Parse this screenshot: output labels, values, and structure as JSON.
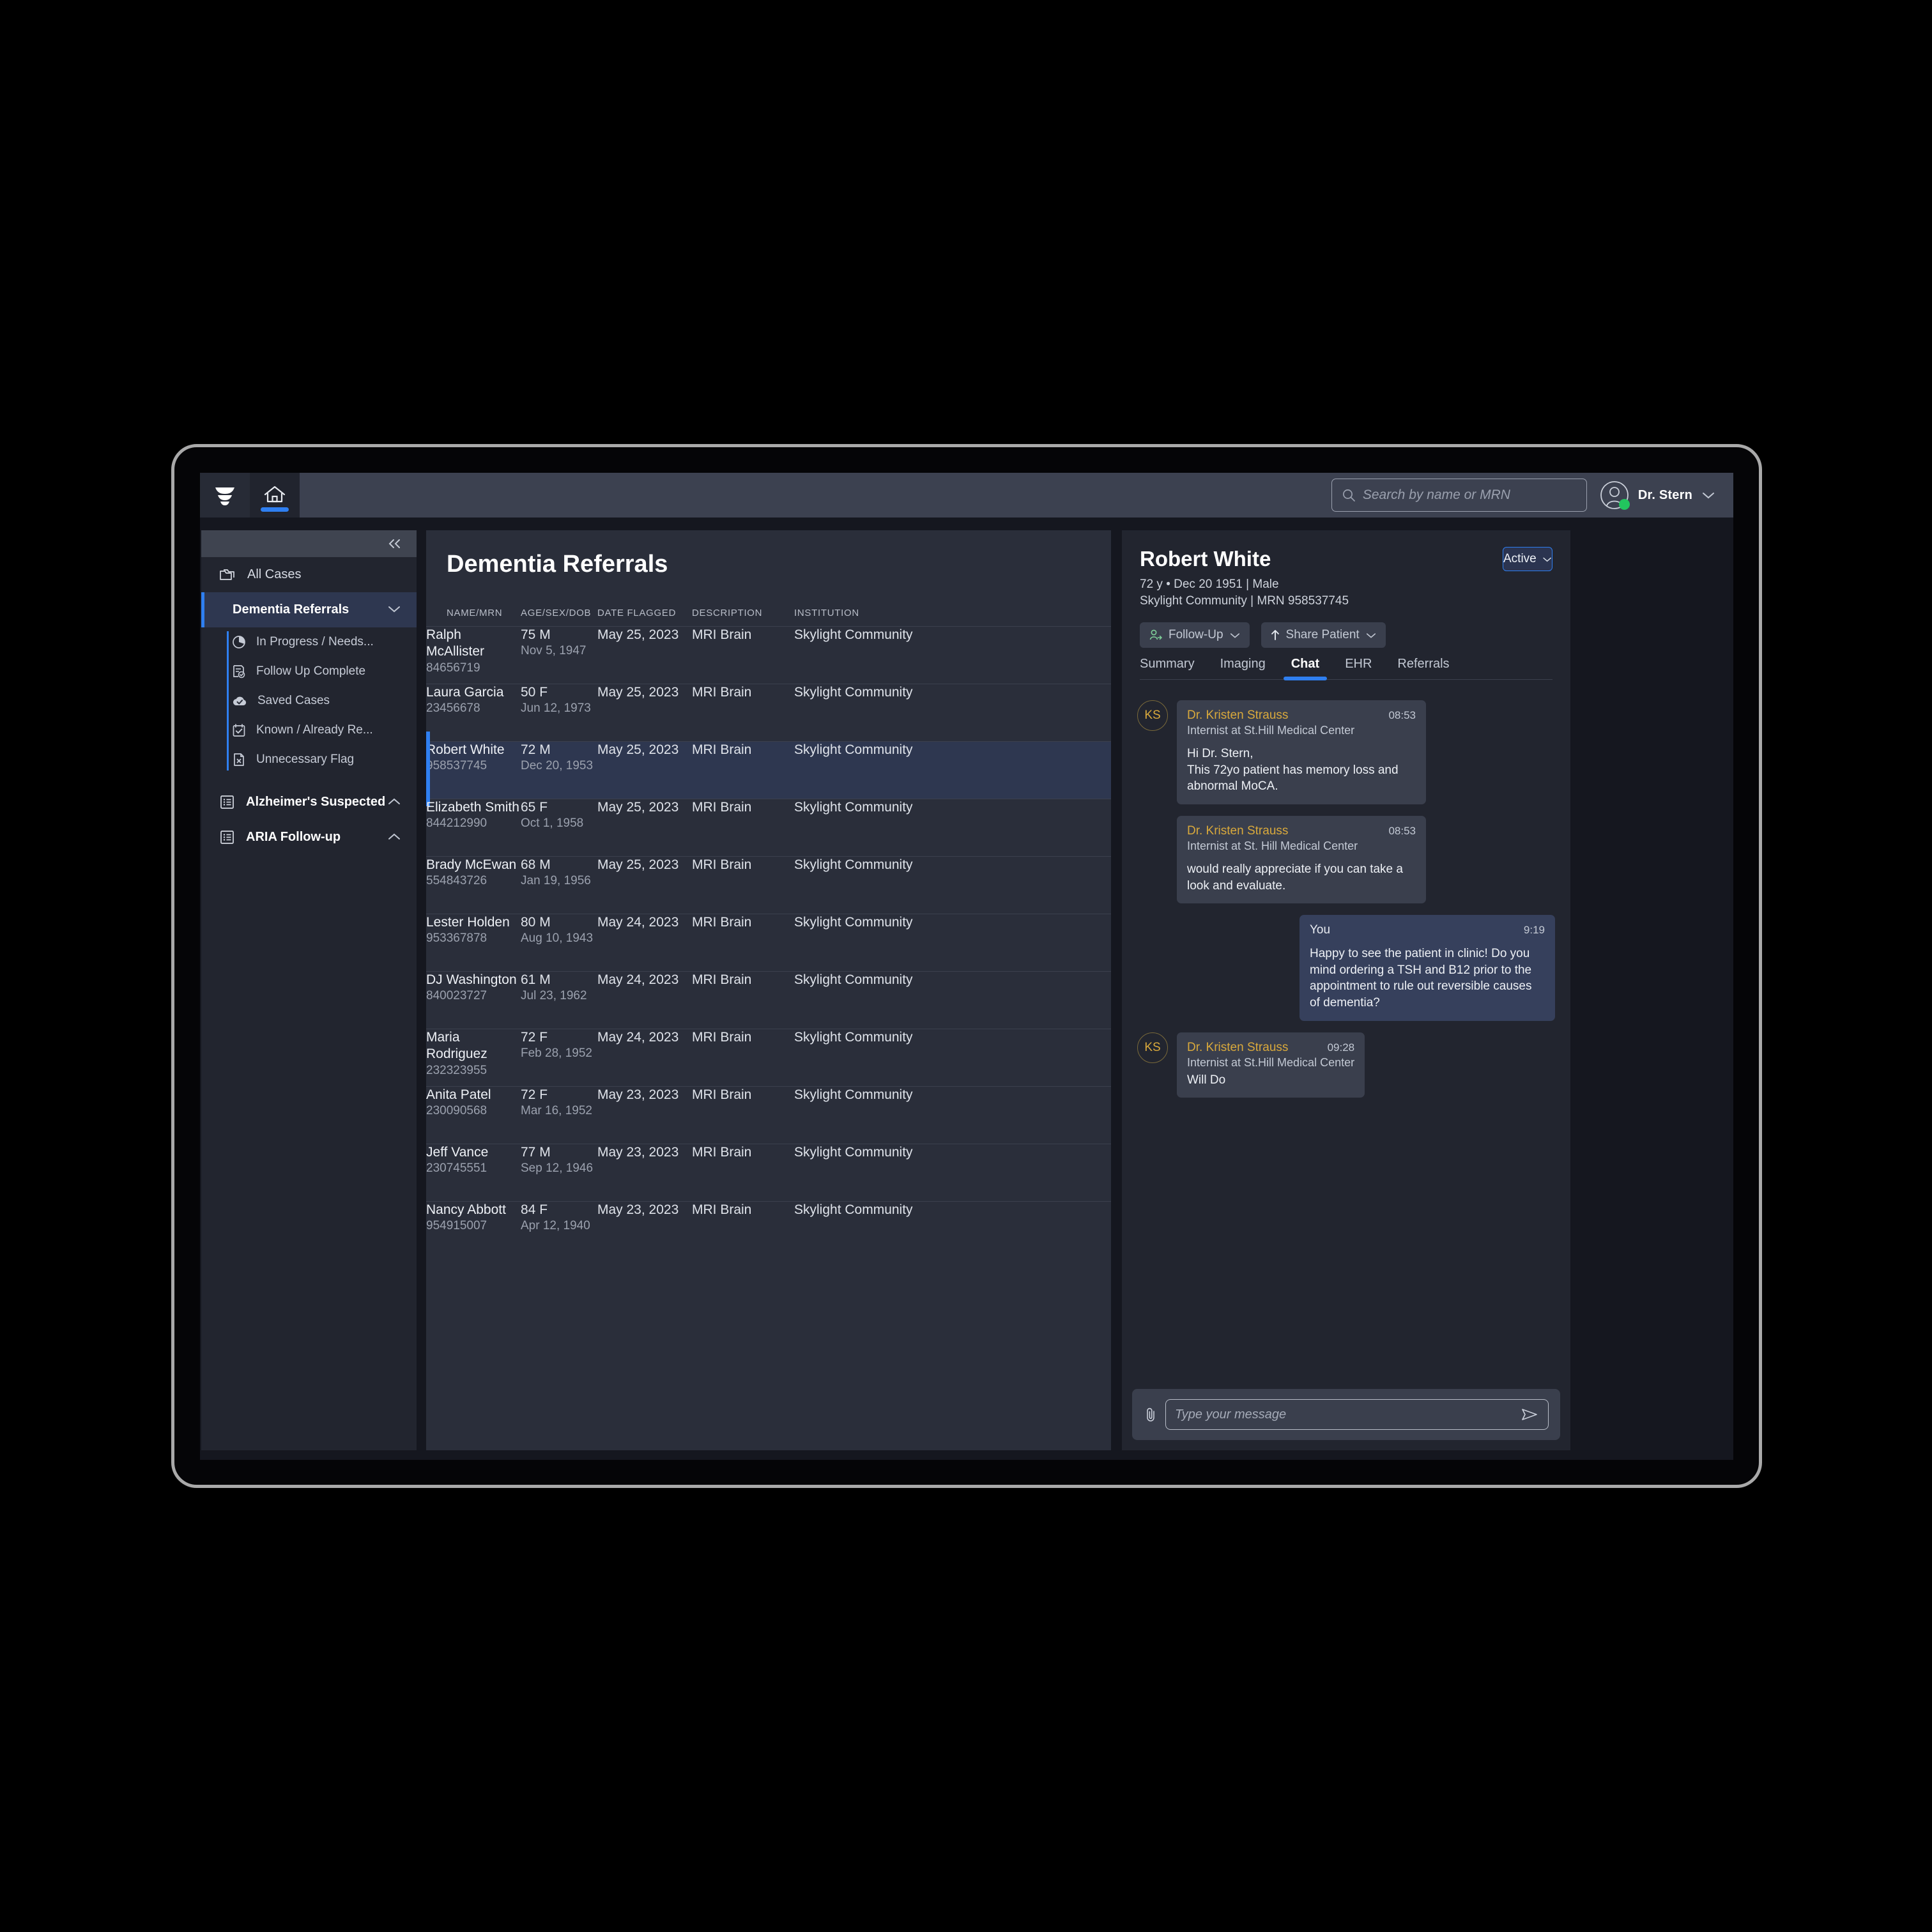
{
  "topbar": {
    "logo_icon": "leaf-stack-logo",
    "home_icon": "home-icon",
    "search": {
      "placeholder": "Search by name or MRN",
      "value": ""
    },
    "search_icon": "search-icon",
    "user_name": "Dr. Stern",
    "user_icon": "user-avatar-icon",
    "user_chevron": "chevron-down-icon"
  },
  "sidebar": {
    "collapse_icon": "double-chevron-left-icon",
    "all_cases": {
      "label": "All Cases",
      "icon": "folders-icon"
    },
    "dementia": {
      "label": "Dementia Referrals",
      "icon": "chevron-down-icon"
    },
    "sub_items": [
      {
        "label": "In Progress / Needs...",
        "icon": "pie-chart-icon"
      },
      {
        "label": "Follow Up Complete",
        "icon": "document-check-icon"
      },
      {
        "label": "Saved Cases",
        "icon": "cloud-check-icon"
      },
      {
        "label": "Known / Already Re...",
        "icon": "calendar-check-icon"
      },
      {
        "label": "Unnecessary Flag",
        "icon": "document-x-icon"
      }
    ],
    "groups": [
      {
        "label": "Alzheimer's Suspected",
        "icon": "list-icon",
        "chevron": "chevron-up-icon"
      },
      {
        "label": "ARIA Follow-up",
        "icon": "list-icon",
        "chevron": "chevron-up-icon"
      }
    ]
  },
  "main": {
    "title": "Dementia Referrals",
    "columns": [
      "NAME/MRN",
      "AGE/SEX/DOB",
      "DATE FLAGGED",
      "DESCRIPTION",
      "INSTITUTION"
    ],
    "rows": [
      {
        "name": "Ralph McAllister",
        "mrn": "84656719",
        "age_sex": "75 M",
        "dob": "Nov 5, 1947",
        "date_flagged": "May 25, 2023",
        "description": "MRI Brain",
        "institution": "Skylight Community",
        "selected": false
      },
      {
        "name": "Laura Garcia",
        "mrn": "23456678",
        "age_sex": "50 F",
        "dob": "Jun 12, 1973",
        "date_flagged": "May 25, 2023",
        "description": "MRI Brain",
        "institution": "Skylight Community",
        "selected": false
      },
      {
        "name": "Robert White",
        "mrn": "958537745",
        "age_sex": "72 M",
        "dob": "Dec 20, 1953",
        "date_flagged": "May 25, 2023",
        "description": "MRI Brain",
        "institution": "Skylight Community",
        "selected": true
      },
      {
        "name": "Elizabeth Smith",
        "mrn": "844212990",
        "age_sex": "65 F",
        "dob": "Oct 1, 1958",
        "date_flagged": "May 25, 2023",
        "description": "MRI Brain",
        "institution": "Skylight Community",
        "selected": false
      },
      {
        "name": "Brady McEwan",
        "mrn": "554843726",
        "age_sex": "68 M",
        "dob": "Jan 19, 1956",
        "date_flagged": "May 25, 2023",
        "description": "MRI Brain",
        "institution": "Skylight Community",
        "selected": false
      },
      {
        "name": "Lester Holden",
        "mrn": "953367878",
        "age_sex": "80 M",
        "dob": "Aug 10, 1943",
        "date_flagged": "May 24, 2023",
        "description": "MRI Brain",
        "institution": "Skylight Community",
        "selected": false
      },
      {
        "name": "DJ Washington",
        "mrn": "840023727",
        "age_sex": "61 M",
        "dob": "Jul 23, 1962",
        "date_flagged": "May 24, 2023",
        "description": "MRI Brain",
        "institution": "Skylight Community",
        "selected": false
      },
      {
        "name": "Maria Rodriguez",
        "mrn": "232323955",
        "age_sex": "72 F",
        "dob": "Feb 28, 1952",
        "date_flagged": "May 24, 2023",
        "description": "MRI Brain",
        "institution": "Skylight Community",
        "selected": false
      },
      {
        "name": "Anita Patel",
        "mrn": "230090568",
        "age_sex": "72 F",
        "dob": "Mar 16, 1952",
        "date_flagged": "May 23, 2023",
        "description": "MRI Brain",
        "institution": "Skylight Community",
        "selected": false
      },
      {
        "name": "Jeff Vance",
        "mrn": "230745551",
        "age_sex": "77 M",
        "dob": "Sep 12, 1946",
        "date_flagged": "May 23, 2023",
        "description": "MRI Brain",
        "institution": "Skylight Community",
        "selected": false
      },
      {
        "name": "Nancy Abbott",
        "mrn": "954915007",
        "age_sex": "84 F",
        "dob": "Apr 12, 1940",
        "date_flagged": "May 23, 2023",
        "description": "MRI Brain",
        "institution": "Skylight Community",
        "selected": false
      }
    ]
  },
  "patient": {
    "name": "Robert White",
    "meta_line1": "72 y • Dec 20 1951 | Male",
    "meta_line2": "Skylight Community | MRN 958537745",
    "status": "Active",
    "status_chevron": "chevron-down-icon",
    "actions": [
      {
        "label": "Follow-Up",
        "icon": "user-add-icon",
        "chevron": "chevron-down-icon"
      },
      {
        "label": "Share Patient",
        "icon": "arrow-up-icon",
        "chevron": "chevron-down-icon"
      }
    ],
    "tabs": [
      {
        "label": "Summary",
        "active": false
      },
      {
        "label": "Imaging",
        "active": false
      },
      {
        "label": "Chat",
        "active": true
      },
      {
        "label": "EHR",
        "active": false
      },
      {
        "label": "Referrals",
        "active": false
      }
    ]
  },
  "chat": {
    "messages": [
      {
        "avatar": "KS",
        "show_avatar": true,
        "side": "left",
        "sender": "Dr. Kristen Strauss",
        "role": "Internist at St.Hill Medical Center",
        "time": "08:53",
        "text": "Hi Dr. Stern,\nThis 72yo patient has memory loss and abnormal MoCA."
      },
      {
        "avatar": "KS",
        "show_avatar": false,
        "side": "left",
        "sender": "Dr. Kristen Strauss",
        "role": "Internist at St. Hill Medical Center",
        "time": "08:53",
        "text": "would really appreciate if you can take a look and evaluate."
      },
      {
        "avatar": "",
        "show_avatar": false,
        "side": "right",
        "sender": "You",
        "role": "",
        "time": "9:19",
        "text": "Happy to see the patient in clinic! Do you mind ordering a TSH and B12 prior to the appointment to rule out reversible causes of dementia?"
      },
      {
        "avatar": "KS",
        "show_avatar": true,
        "side": "left",
        "sender": "Dr. Kristen Strauss",
        "role": "Internist at St.Hill Medical Center",
        "time": "09:28",
        "text": "Will Do"
      }
    ],
    "composer": {
      "attach_icon": "paperclip-icon",
      "placeholder": "Type your message",
      "value": "",
      "send_icon": "send-icon"
    }
  },
  "colors": {
    "accent": "#2f7ff0",
    "sender_name": "#d9a93c",
    "online": "#22c55e",
    "panel": "#22252f",
    "center_panel": "#2a2e3a"
  }
}
